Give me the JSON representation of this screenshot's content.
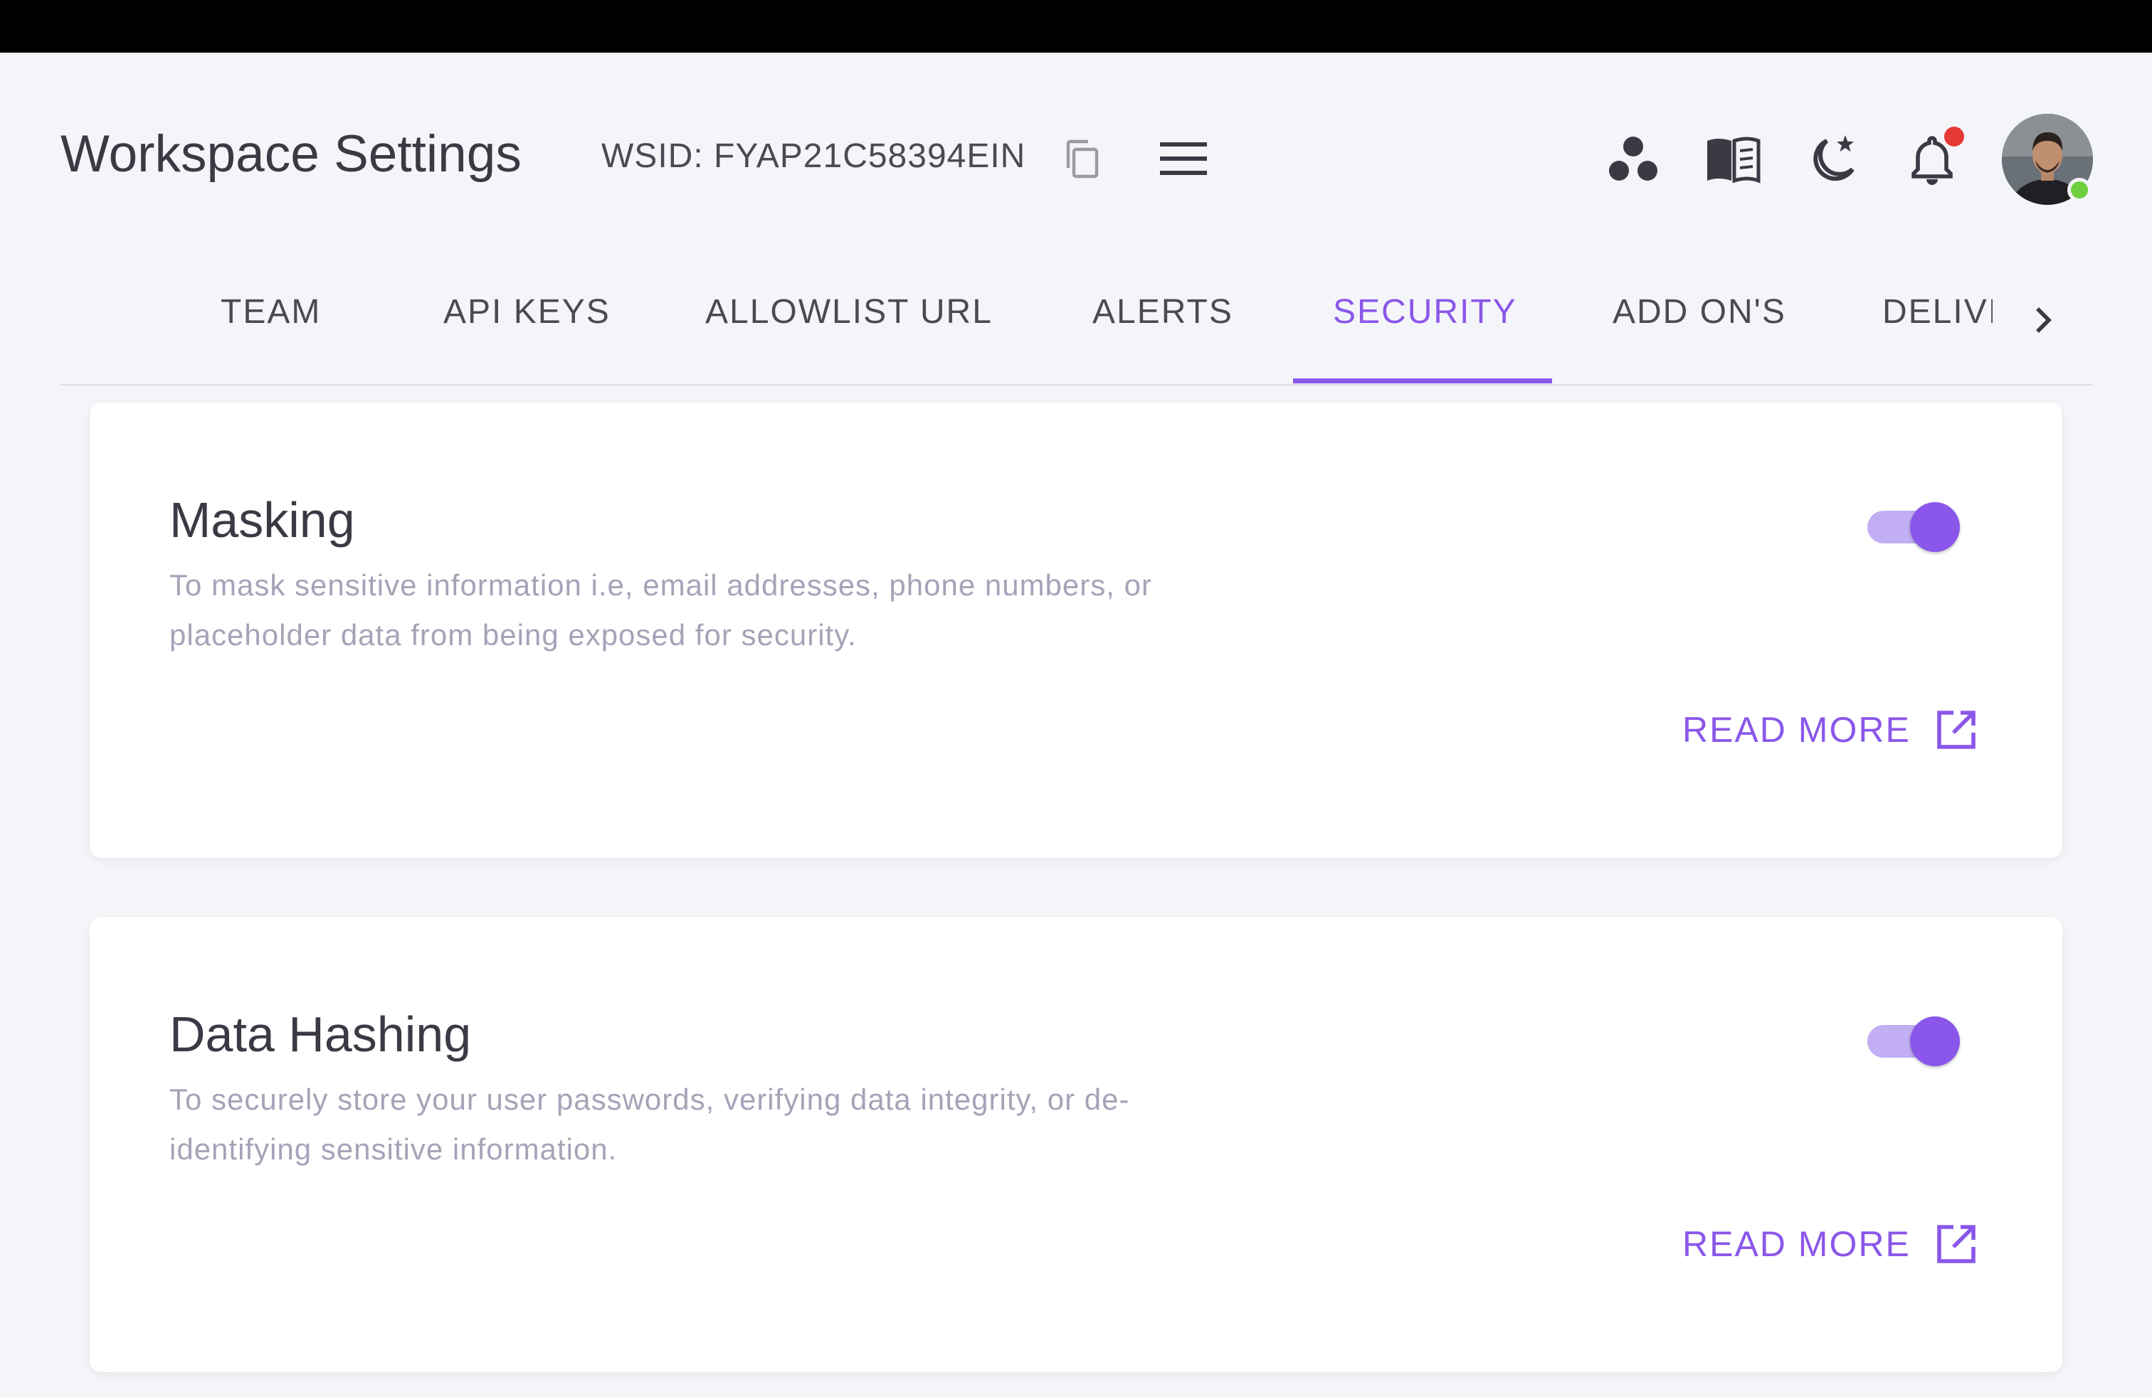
{
  "header": {
    "title": "Workspace Settings",
    "wsid": "WSID: FYAP21C58394EIN",
    "icons": [
      "copy-icon",
      "menu-icon",
      "apps-dots-icon",
      "book-icon",
      "moon-star-icon",
      "bell-icon"
    ],
    "notification_dot": true,
    "user_online": true
  },
  "tabs": {
    "items": [
      {
        "label": "TEAM"
      },
      {
        "label": "API KEYS"
      },
      {
        "label": "ALLOWLIST URL"
      },
      {
        "label": "ALERTS"
      },
      {
        "label": "SECURITY"
      },
      {
        "label": "ADD ON'S"
      },
      {
        "label": "DELIVI"
      }
    ],
    "active": "SECURITY"
  },
  "cards": [
    {
      "title": "Masking",
      "description": "To mask sensitive information i.e, email addresses, phone numbers, or placeholder data from being exposed for security.",
      "enabled": true,
      "read_more": "READ MORE"
    },
    {
      "title": "Data Hashing",
      "description": "To securely store your user passwords, verifying data integrity, or de-identifying sensitive information.",
      "enabled": true,
      "read_more": "READ MORE"
    }
  ],
  "colors": {
    "accent": "#8a57ea",
    "toggle_track": "#c1aef3",
    "text_dark": "#3a3a45",
    "text_muted": "#a5a3b8",
    "background": "#f4f5f9",
    "notification": "#e53935",
    "online": "#6fcf3f"
  }
}
